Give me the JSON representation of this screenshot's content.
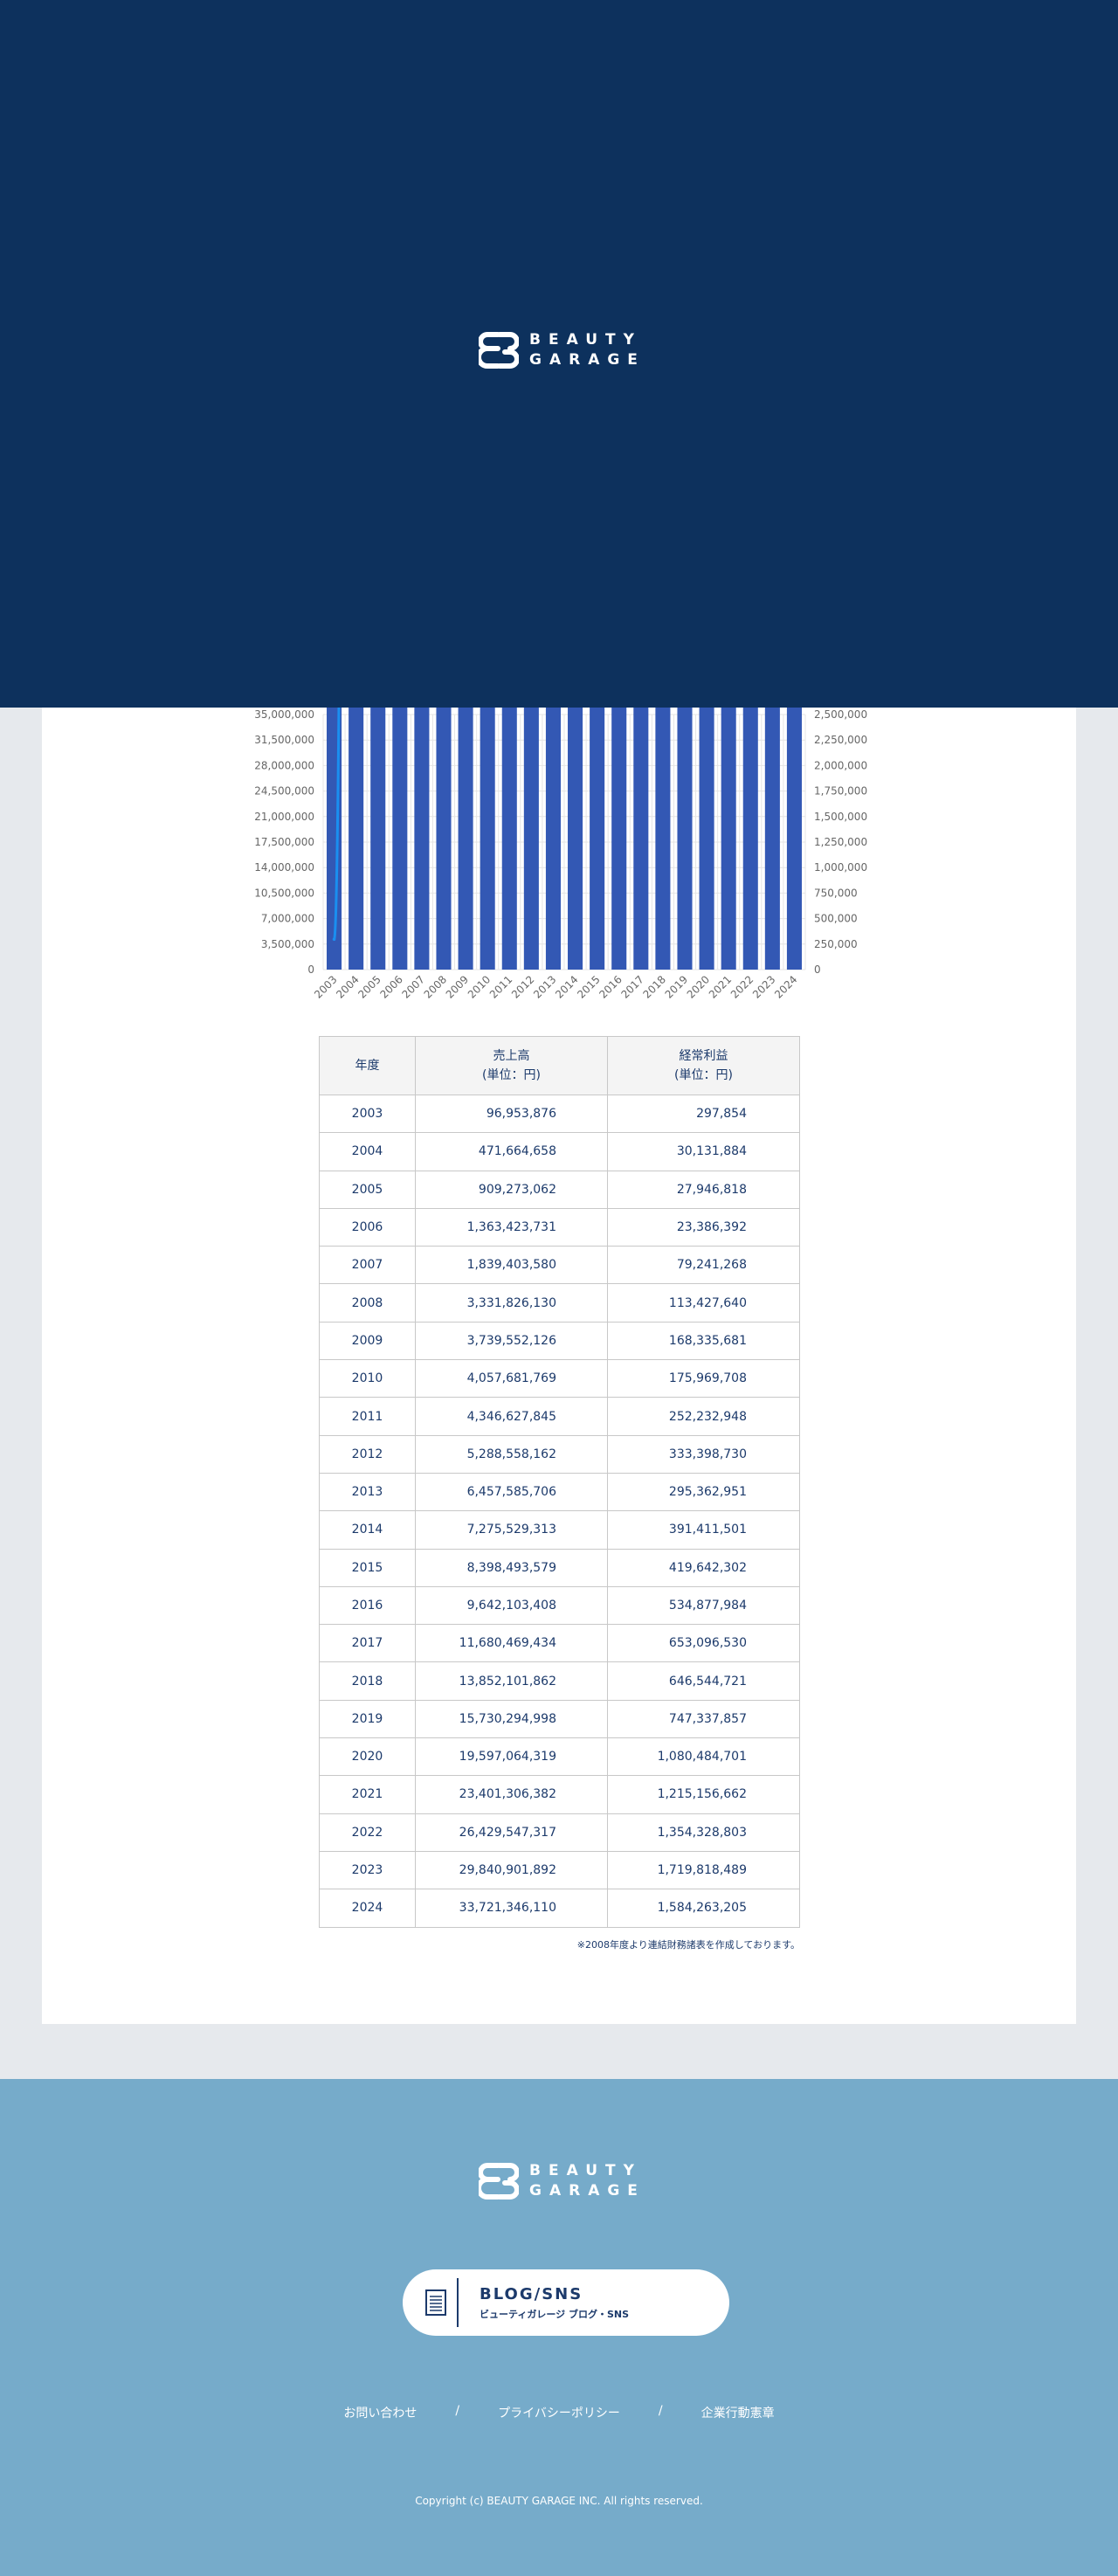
{
  "brand": {
    "line1": "BEAUTY",
    "line2": "GARAGE"
  },
  "chart_data": {
    "type": "bar",
    "categories": [
      "2003",
      "2004",
      "2005",
      "2006",
      "2007",
      "2008",
      "2009",
      "2010",
      "2011",
      "2012",
      "2013",
      "2014",
      "2015",
      "2016",
      "2017",
      "2018",
      "2019",
      "2020",
      "2021",
      "2022",
      "2023",
      "2024"
    ],
    "series": [
      {
        "type": "bar",
        "axis": "left",
        "values": [
          96953876,
          471664658,
          909273062,
          1363423731,
          1839403580,
          3331826130,
          3739552126,
          4057681769,
          4346627845,
          5288558162,
          6457585706,
          7275529313,
          8398493579,
          9642103408,
          11680469434,
          13852101862,
          15730294998,
          19597064319,
          23401306382,
          26429547317,
          29840901892,
          33721346110
        ]
      },
      {
        "type": "line",
        "axis": "right",
        "values": [
          297854,
          30131884,
          27946818,
          23386392,
          79241268,
          113427640,
          168335681,
          175969708,
          252232948,
          333398730,
          295362951,
          391411501,
          419642302,
          534877984,
          653096530,
          646544721,
          747337857,
          1080484701,
          1215156662,
          1354328803,
          1719818489,
          1584263205
        ]
      }
    ],
    "left_axis": {
      "ticks": [
        "35,000,000",
        "31,500,000",
        "28,000,000",
        "24,500,000",
        "21,000,000",
        "17,500,000",
        "14,000,000",
        "10,500,000",
        "7,000,000",
        "3,500,000",
        "0"
      ],
      "ylim": [
        0,
        35000000
      ]
    },
    "right_axis": {
      "ticks": [
        "2,500,000",
        "2,250,000",
        "2,000,000",
        "1,750,000",
        "1,500,000",
        "1,250,000",
        "1,000,000",
        "750,000",
        "500,000",
        "250,000",
        "0"
      ],
      "ylim": [
        0,
        2500000
      ]
    },
    "grid": true,
    "colors": {
      "bar": "#3358b4",
      "line": "#1a8ff0",
      "grid": "#e4e4e4"
    }
  },
  "table": {
    "headers": [
      {
        "line1": "年度",
        "line2": ""
      },
      {
        "line1": "売上高",
        "line2": "(単位：円)"
      },
      {
        "line1": "経常利益",
        "line2": "(単位：円)"
      }
    ],
    "rows": [
      [
        "2003",
        "96,953,876",
        "297,854"
      ],
      [
        "2004",
        "471,664,658",
        "30,131,884"
      ],
      [
        "2005",
        "909,273,062",
        "27,946,818"
      ],
      [
        "2006",
        "1,363,423,731",
        "23,386,392"
      ],
      [
        "2007",
        "1,839,403,580",
        "79,241,268"
      ],
      [
        "2008",
        "3,331,826,130",
        "113,427,640"
      ],
      [
        "2009",
        "3,739,552,126",
        "168,335,681"
      ],
      [
        "2010",
        "4,057,681,769",
        "175,969,708"
      ],
      [
        "2011",
        "4,346,627,845",
        "252,232,948"
      ],
      [
        "2012",
        "5,288,558,162",
        "333,398,730"
      ],
      [
        "2013",
        "6,457,585,706",
        "295,362,951"
      ],
      [
        "2014",
        "7,275,529,313",
        "391,411,501"
      ],
      [
        "2015",
        "8,398,493,579",
        "419,642,302"
      ],
      [
        "2016",
        "9,642,103,408",
        "534,877,984"
      ],
      [
        "2017",
        "11,680,469,434",
        "653,096,530"
      ],
      [
        "2018",
        "13,852,101,862",
        "646,544,721"
      ],
      [
        "2019",
        "15,730,294,998",
        "747,337,857"
      ],
      [
        "2020",
        "19,597,064,319",
        "1,080,484,701"
      ],
      [
        "2021",
        "23,401,306,382",
        "1,215,156,662"
      ],
      [
        "2022",
        "26,429,547,317",
        "1,354,328,803"
      ],
      [
        "2023",
        "29,840,901,892",
        "1,719,818,489"
      ],
      [
        "2024",
        "33,721,346,110",
        "1,584,263,205"
      ]
    ],
    "note": "※2008年度より連結財務諸表を作成しております。"
  },
  "footer": {
    "blog": {
      "title": "BLOG/SNS",
      "subtitle": "ビューティガレージ ブログ・SNS",
      "icon": "document-icon"
    },
    "links": [
      "お問い合わせ",
      "/",
      "プライバシーポリシー",
      "/",
      "企業行動憲章"
    ],
    "copyright": "Copyright (c) BEAUTY GARAGE INC. All rights reserved."
  },
  "colors": {
    "hero_bg": "#0d315d",
    "footer_bg": "#76abca",
    "page_bg": "#e6e9ed",
    "text": "#1c3a6b"
  }
}
